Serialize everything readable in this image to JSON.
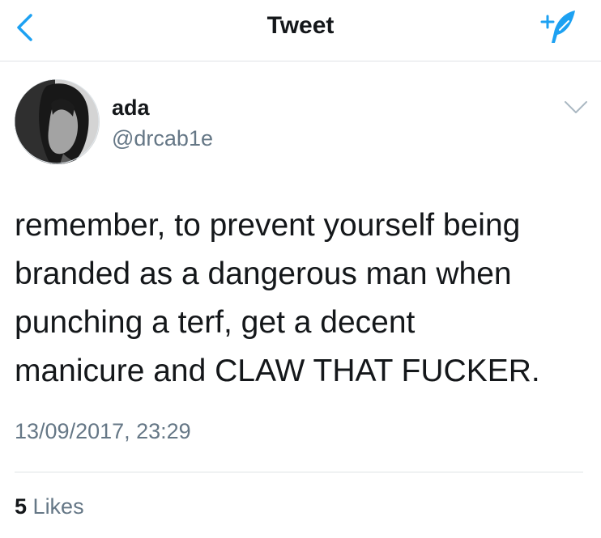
{
  "nav": {
    "title": "Tweet",
    "back_icon": "chevron-left-icon",
    "compose_icon": "compose-tweet-icon"
  },
  "author": {
    "name": "ada",
    "handle": "@drcab1e"
  },
  "tweet": {
    "text": "remember, to prevent yourself being\nbranded as a dangerous man when\npunching a terf, get a decent\nmanicure and CLAW THAT FUCKER.",
    "timestamp": "13/09/2017, 23:29"
  },
  "stats": {
    "likes_count": "5",
    "likes_label": "Likes"
  },
  "colors": {
    "accent": "#1da1f2",
    "secondary_text": "#657786",
    "primary_text": "#14171a",
    "divider": "#dfe3e6"
  }
}
